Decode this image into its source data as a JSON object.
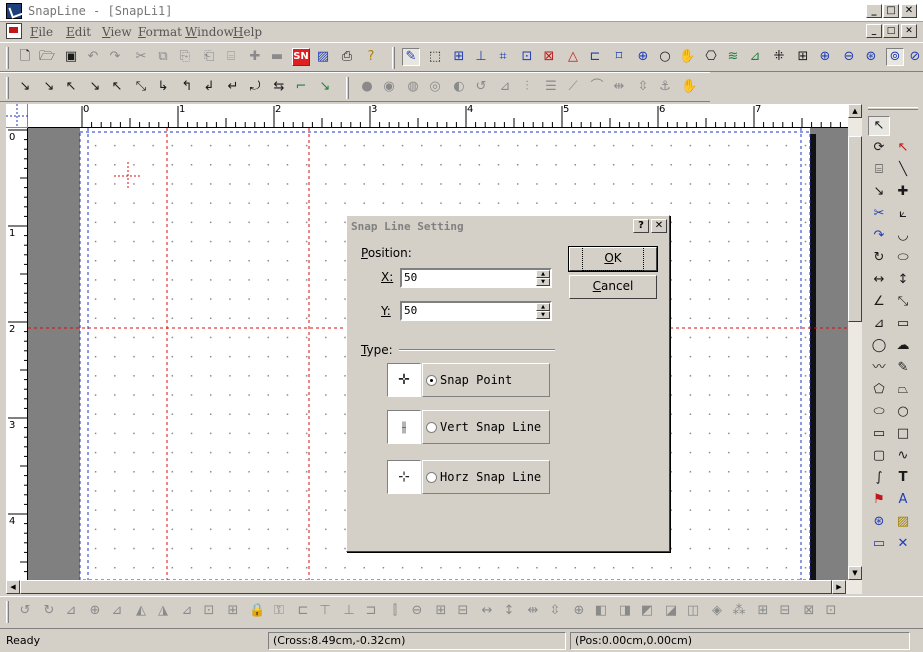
{
  "window": {
    "title": "SnapLine - [SnapLi1]",
    "controls": {
      "minimize": "_",
      "maximize": "□",
      "close": "✕"
    }
  },
  "menu": {
    "items": [
      "File",
      "Edit",
      "View",
      "Format",
      "Window",
      "Help"
    ],
    "doc_controls": {
      "minimize": "_",
      "restore": "□",
      "close": "✕"
    }
  },
  "toolbar_main": {
    "sn_label": "SN"
  },
  "rulers": {
    "horizontal_labels": [
      "0",
      "1",
      "2",
      "3",
      "4",
      "5",
      "6",
      "7"
    ],
    "vertical_labels": [
      "0",
      "1",
      "2",
      "3",
      "4"
    ]
  },
  "dialog": {
    "title": "Snap Line Setting",
    "help_button": "?",
    "close_button": "✕",
    "position_label": "Position:",
    "x_label": "X:",
    "x_value": "50",
    "y_label": "Y:",
    "y_value": "50",
    "ok_label": "OK",
    "cancel_label": "Cancel",
    "type_label": "Type:",
    "types": [
      {
        "label": "Snap Point",
        "checked": true
      },
      {
        "label": "Vert Snap Line",
        "checked": false
      },
      {
        "label": "Horz Snap Line",
        "checked": false
      }
    ]
  },
  "status": {
    "ready": "Ready",
    "cross": "(Cross:8.49cm,-0.32cm)",
    "pos": "(Pos:0.00cm,0.00cm)"
  },
  "colors": {
    "snap_line_red": "#d01010",
    "snap_line_blue": "#2030c0",
    "sn_button": "#e02020",
    "face": "#d4d0c8"
  }
}
